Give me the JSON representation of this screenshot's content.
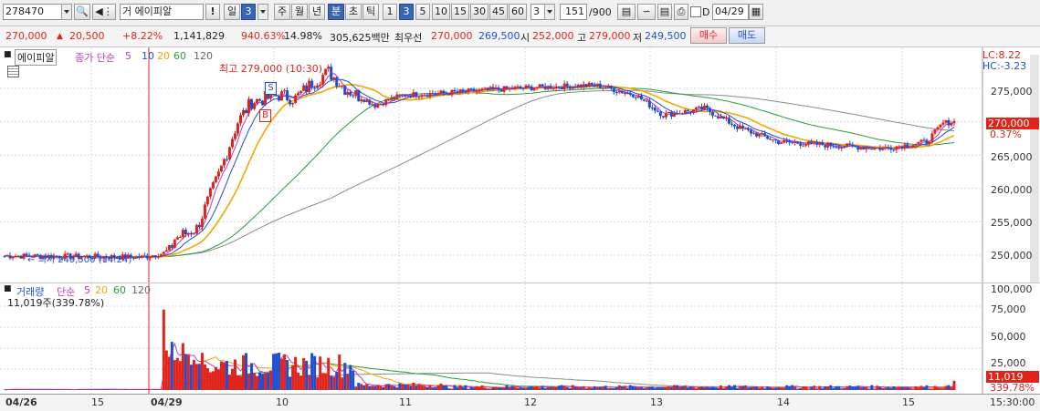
{
  "toolbar": {
    "stock_code": "278470",
    "stock_name": "에이피알",
    "grade_label": "거",
    "alert_label": "!",
    "period_tabs": [
      "일",
      "3",
      "주",
      "월",
      "년",
      "분",
      "초",
      "틱"
    ],
    "minute_presets": [
      "1",
      "3",
      "5",
      "10",
      "15",
      "30",
      "45",
      "60"
    ],
    "selected_minute": "3",
    "interval_value": "3",
    "count_display": "151",
    "count_total": "/900",
    "date_checkbox_label": "D",
    "date_value": "04/29"
  },
  "info": {
    "price": "270,000",
    "change": "20,500",
    "change_pct": "+8.22%",
    "volume": "1,141,829",
    "volume_ratio": "940.63%",
    "turnover": "14.98%",
    "trade_value": "305,625백만",
    "best_bid_label": "최우선",
    "best_ask": "270,000",
    "best_bid": "269,500",
    "open_label": "시",
    "open": "252,000",
    "high_label": "고",
    "high": "279,000",
    "low_label": "저",
    "low": "249,500",
    "buy_label": "매수",
    "sell_label": "매도"
  },
  "price_legend": {
    "name": "에이피알",
    "close_label": "종가 단순",
    "ma_periods": [
      "5",
      "10",
      "20",
      "60",
      "120"
    ],
    "lc_label": "LC:8.22",
    "hc_label": "HC:-3.23",
    "max_annotation": "최고 279,000 (10:30)",
    "min_annotation": "최저 249,500 (14:24)",
    "current_price_badge": "270,000",
    "current_pct": "0.37%"
  },
  "vol_legend": {
    "label": "거래량",
    "ma_label": "단순",
    "ma_periods": [
      "5",
      "20",
      "60",
      "120"
    ],
    "volume_text": "11,019주(339.78%)",
    "badge_volume": "11,019",
    "badge_pct": "339.78%"
  },
  "price_axis": [
    "275,000",
    "270,000",
    "265,000",
    "260,000",
    "255,000",
    "250,000"
  ],
  "vol_axis": [
    "100,000",
    "75,000",
    "50,000",
    "25,000"
  ],
  "x_axis": {
    "labels": [
      "04/26",
      "15",
      "04/29",
      "10",
      "11",
      "12",
      "13",
      "14",
      "15"
    ],
    "time_label": "15:30:00"
  },
  "colors": {
    "up": "#e0241c",
    "down": "#1f4fd1",
    "ma5": "#c23bbd",
    "ma10": "#1f4fd1",
    "ma20": "#f0a800",
    "ma60": "#2a9a3a",
    "ma120": "#8a8a8a",
    "bg": "#ffffff",
    "accent": "#3c64b4"
  }
}
